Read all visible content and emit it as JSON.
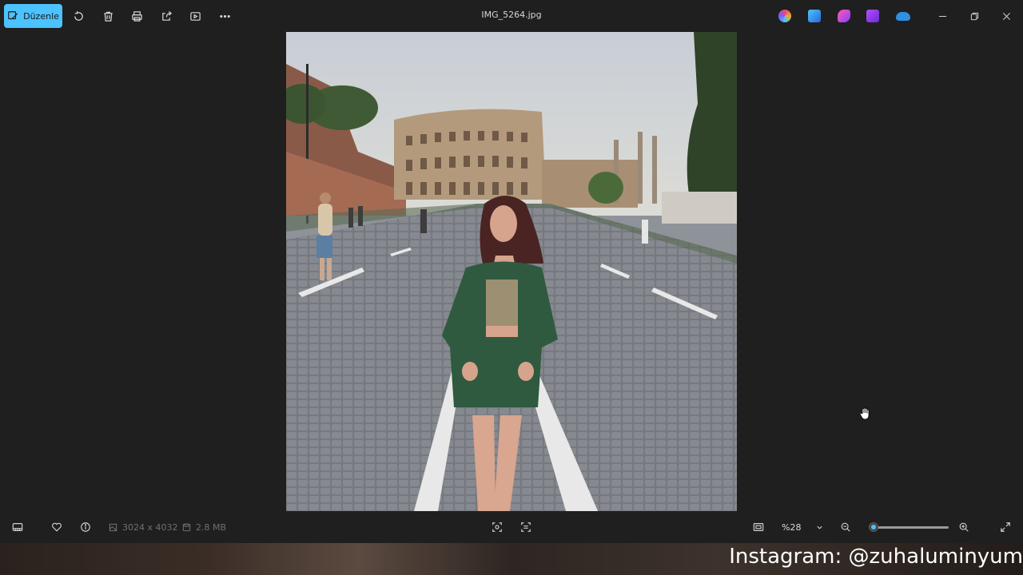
{
  "toolbar": {
    "edit_label": "Düzenle",
    "file_title": "IMG_5264.jpg"
  },
  "toolbar_icons": [
    "edit-icon",
    "rotate-icon",
    "delete-icon",
    "print-icon",
    "share-icon",
    "slideshow-icon",
    "more-icon"
  ],
  "apps": [
    "copilot-icon",
    "designer-icon",
    "clipchamp-icon",
    "photos-icon",
    "onedrive-icon"
  ],
  "statusbar": {
    "dimensions": "3024 x 4032",
    "file_size": "2.8 MB",
    "zoom": "%28",
    "zoom_level": 0.05
  },
  "overlay": {
    "watermark": "Instagram: @zuhaluminyum"
  },
  "colors": {
    "accent": "#4cc2ff",
    "background": "#1f1f1f"
  }
}
